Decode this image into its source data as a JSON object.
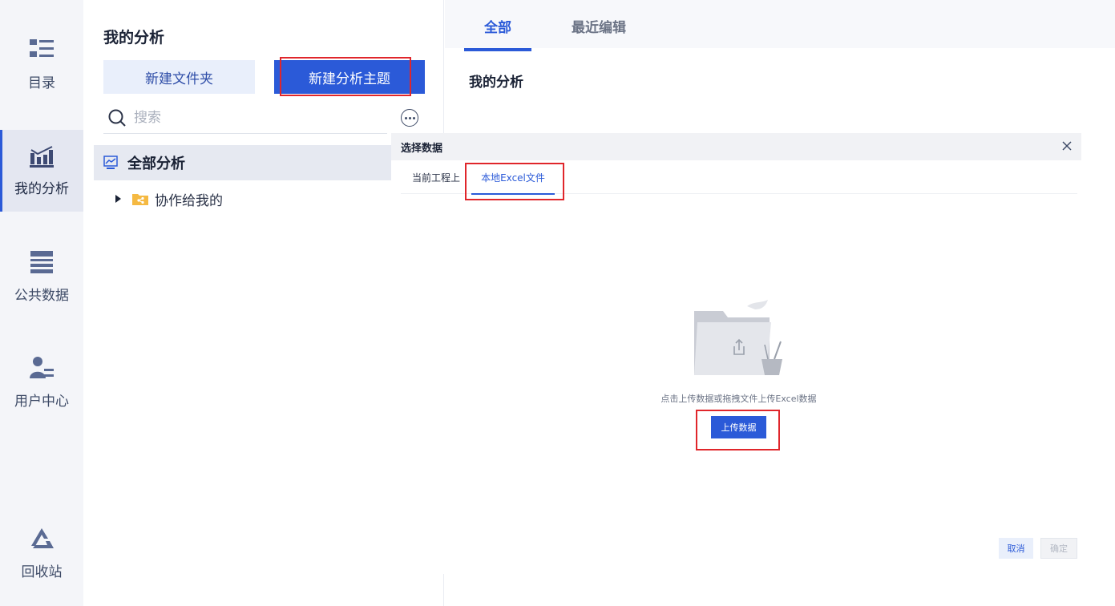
{
  "rail": {
    "items": [
      {
        "label": "目录",
        "icon": "list-icon"
      },
      {
        "label": "我的分析",
        "icon": "bar-chart-icon",
        "active": true
      },
      {
        "label": "公共数据",
        "icon": "database-icon"
      },
      {
        "label": "用户中心",
        "icon": "user-icon"
      },
      {
        "label": "回收站",
        "icon": "recycle-icon"
      }
    ]
  },
  "tree": {
    "title": "我的分析",
    "new_folder_label": "新建文件夹",
    "new_topic_label": "新建分析主题",
    "search_placeholder": "搜索",
    "all_label": "全部分析",
    "shared_label": "协作给我的"
  },
  "main": {
    "tabs": [
      {
        "label": "全部",
        "active": true
      },
      {
        "label": "最近编辑",
        "active": false
      }
    ],
    "title": "我的分析"
  },
  "dialog": {
    "title": "选择数据",
    "tabs": [
      {
        "label": "当前工程上",
        "active": false
      },
      {
        "label": "本地Excel文件",
        "active": true
      }
    ],
    "hint": "点击上传数据或拖拽文件上传Excel数据",
    "upload_label": "上传数据",
    "cancel_label": "取消",
    "ok_label": "确定"
  },
  "colors": {
    "accent": "#2b5ad8",
    "highlight": "#e0262b",
    "rail_bg": "#f4f5f9"
  }
}
